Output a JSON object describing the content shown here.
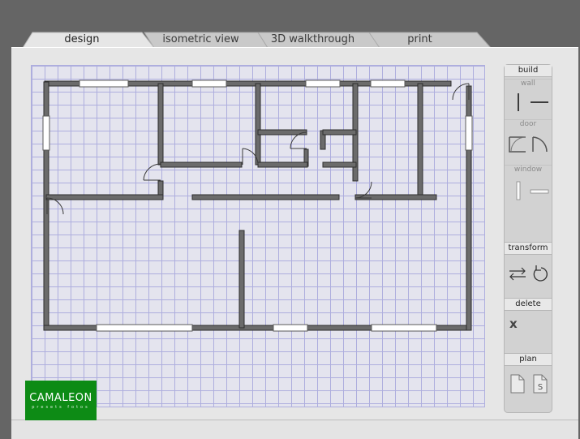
{
  "tabs": [
    {
      "label": "design",
      "active": true
    },
    {
      "label": "isometric view",
      "active": false
    },
    {
      "label": "3D walkthrough",
      "active": false
    },
    {
      "label": "print",
      "active": false
    }
  ],
  "toolbar": {
    "build_label": "build",
    "wall_label": "wall",
    "door_label": "door",
    "window_label": "window",
    "transform_label": "transform",
    "delete_label": "delete",
    "delete_icon_text": "x",
    "plan_label": "plan",
    "plan_save_letter": "S"
  },
  "logo": {
    "brand": "CAMALEON",
    "subtitle": "presets fotos"
  },
  "colors": {
    "background": "#656565",
    "panel": "#e6e6e6",
    "grid_line": "#aeaede",
    "wall": "#6b6b6b",
    "logo_green": "#0d8b15"
  },
  "icons": [
    "wall-vertical-icon",
    "wall-horizontal-icon",
    "door-left-icon",
    "door-right-icon",
    "window-vertical-icon",
    "window-horizontal-icon",
    "flip-icon",
    "rotate-icon",
    "delete-x-icon",
    "plan-open-icon",
    "plan-save-icon"
  ]
}
